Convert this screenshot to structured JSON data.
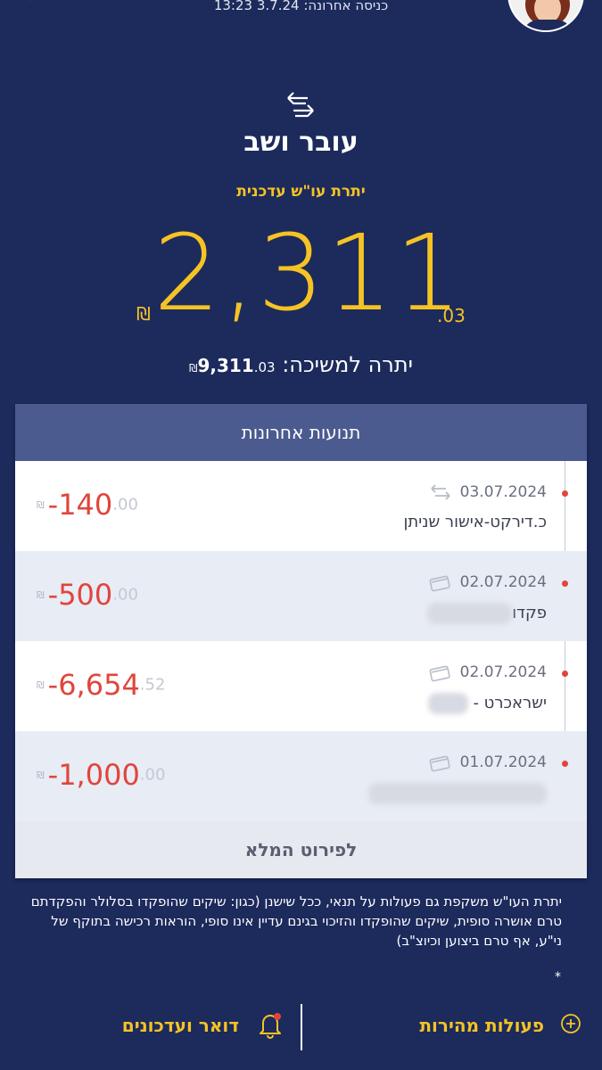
{
  "header": {
    "last_login": "כניסה אחרונה: 3.7.24 13:23"
  },
  "account": {
    "title": "עובר ושב",
    "balance_label": "יתרת עו\"ש עדכנית",
    "balance_int": "2,311",
    "balance_dec": ".03",
    "currency": "₪"
  },
  "withdraw": {
    "label": "יתרה למשיכה:",
    "amount_int": "9,311",
    "amount_dec": ".03",
    "currency": "₪"
  },
  "transactions": {
    "header": "תנועות אחרונות",
    "items": [
      {
        "date": "03.07.2024",
        "description": "כ.דירקט-אישור שניתן",
        "amount_int": "-140",
        "amount_dec": ".00",
        "currency": "₪",
        "icon": "transfer-icon"
      },
      {
        "date": "02.07.2024",
        "description": "פקדו",
        "amount_int": "-500",
        "amount_dec": ".00",
        "currency": "₪",
        "icon": "card-icon"
      },
      {
        "date": "02.07.2024",
        "description": "ישראכרט -",
        "amount_int": "-6,654",
        "amount_dec": ".52",
        "currency": "₪",
        "icon": "card-icon"
      },
      {
        "date": "01.07.2024",
        "description": "",
        "amount_int": "-1,000",
        "amount_dec": ".00",
        "currency": "₪",
        "icon": "card-icon"
      }
    ],
    "full_details": "לפירוט המלא"
  },
  "disclaimer": "יתרת העו\"ש משקפת גם פעולות על תנאי, ככל שישנן (כגון: שיקים שהופקדו בסלולר והפקדתם טרם אושרה סופית, שיקים שהופקדו והזיכוי בגינם עדיין אינו סופי, הוראות רכישה בתוקף של ני\"ע, אף טרם ביצוען וכיוצ\"ב)",
  "asterisk": "*",
  "bottom_nav": {
    "mail_label": "דואר ועדכונים",
    "quick_label": "פעולות מהירות"
  },
  "colors": {
    "background": "#1c2a5c",
    "accent": "#f6c324",
    "negative": "#e0453c",
    "card_header": "#4c5b8f"
  }
}
